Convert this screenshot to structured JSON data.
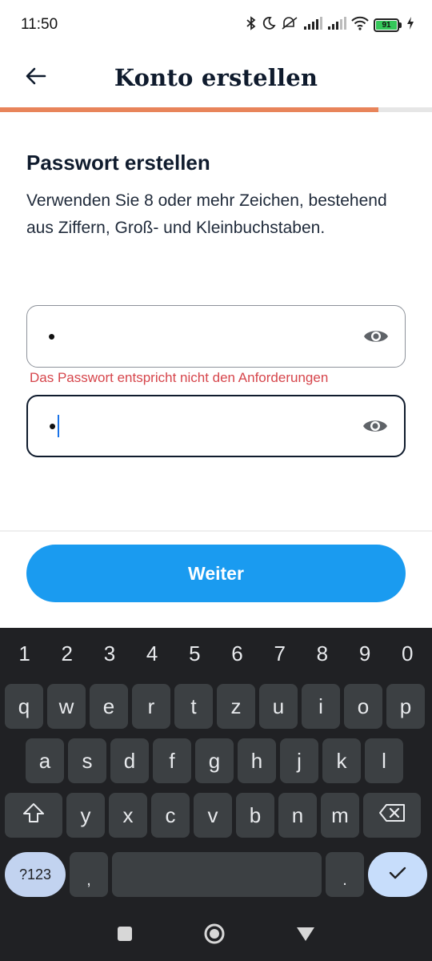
{
  "status_bar": {
    "time": "11:50",
    "battery_level": "91"
  },
  "app_bar": {
    "title": "Konto erstellen"
  },
  "progress": {
    "fraction": 0.875,
    "color": "#e8845a"
  },
  "content": {
    "heading": "Passwort erstellen",
    "description": "Verwenden Sie 8 oder mehr Zeichen, bestehend aus Ziffern, Groß- und Kleinbuchstaben."
  },
  "password_field": {
    "masked_value": "•"
  },
  "error": {
    "message": "Das Passwort entspricht nicht den Anforderungen",
    "color": "#d6454b"
  },
  "confirm_field": {
    "masked_value": "•"
  },
  "primary_button": {
    "label": "Weiter",
    "color": "#1a9bf0"
  },
  "keyboard": {
    "numbers": [
      "1",
      "2",
      "3",
      "4",
      "5",
      "6",
      "7",
      "8",
      "9",
      "0"
    ],
    "row1": [
      "q",
      "w",
      "e",
      "r",
      "t",
      "z",
      "u",
      "i",
      "o",
      "p"
    ],
    "row2": [
      "a",
      "s",
      "d",
      "f",
      "g",
      "h",
      "j",
      "k",
      "l"
    ],
    "row3": [
      "y",
      "x",
      "c",
      "v",
      "b",
      "n",
      "m"
    ],
    "symbols_label": "?123",
    "comma": ",",
    "period": "."
  },
  "icons": {
    "back": "arrow-left-icon",
    "visibility": "eye-icon",
    "shift": "shift-icon",
    "backspace": "backspace-icon",
    "enter": "check-icon",
    "nav_recents": "square-icon",
    "nav_home": "circle-icon",
    "nav_back": "triangle-icon"
  }
}
